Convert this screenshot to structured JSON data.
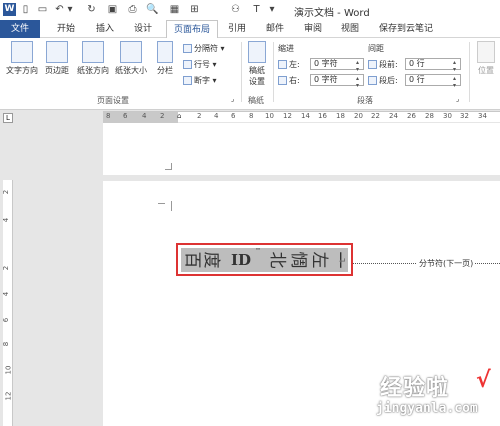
{
  "titlebar": {
    "title": "演示文档 - Word",
    "qat_icons": [
      "word-logo",
      "new-doc-icon",
      "open-icon",
      "undo-icon",
      "redo-icon",
      "save-icon",
      "print-icon",
      "print-preview-icon",
      "table-icon",
      "binoculars-icon",
      "text-icon"
    ]
  },
  "tabs": [
    "文件",
    "开始",
    "插入",
    "设计",
    "页面布局",
    "引用",
    "邮件",
    "审阅",
    "视图",
    "保存到云笔记"
  ],
  "ribbon": {
    "text_direction": "文字方向",
    "margins": "页边距",
    "orientation": "纸张方向",
    "size": "纸张大小",
    "columns": "分栏",
    "breaks": "分隔符",
    "line_numbers": "行号",
    "hyphenation": "断字",
    "page_setup_group": "页面设置",
    "draft_paper": "稿纸\n设置",
    "draft_paper_line1": "稿纸",
    "draft_paper_line2": "设置",
    "draft_group": "稿纸",
    "indent_label": "缩进",
    "spacing_label": "间距",
    "indent_left_label": "左:",
    "indent_left_value": "0 字符",
    "indent_right_label": "右:",
    "indent_right_value": "0 字符",
    "spacing_before_label": "段前:",
    "spacing_before_value": "0 行",
    "spacing_after_label": "段后:",
    "spacing_after_value": "0 行",
    "paragraph_group": "段落",
    "position": "位置"
  },
  "ruler": {
    "numbers": [
      "8",
      "6",
      "4",
      "2",
      "2",
      "4",
      "6",
      "8",
      "10",
      "12",
      "14",
      "16",
      "18",
      "20",
      "22",
      "24",
      "26",
      "28",
      "30",
      "32",
      "34"
    ],
    "vertical_numbers": [
      "2",
      "4",
      "2",
      "4",
      "6",
      "8",
      "10",
      "12"
    ],
    "corner": "L"
  },
  "document": {
    "vertical_chars": [
      "百",
      "度",
      "ID",
      "¨",
      "北",
      "惆",
      "左",
      "一"
    ],
    "section_break": "分节符(下一页)"
  },
  "watermark": {
    "main": "经验啦",
    "sub": "jingyanla.com",
    "check": "√"
  }
}
